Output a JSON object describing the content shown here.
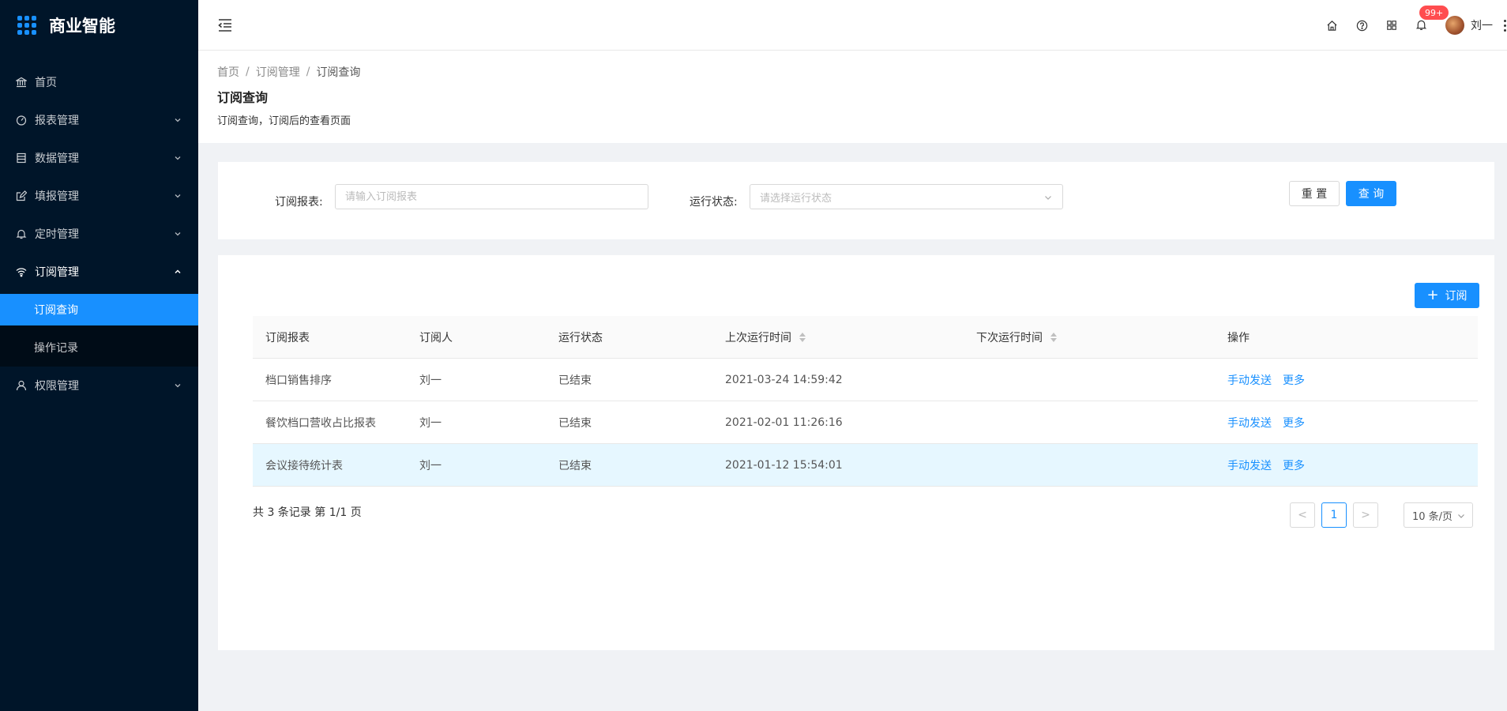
{
  "app": {
    "title": "商业智能"
  },
  "sidebar": {
    "items": [
      {
        "label": "首页",
        "icon": "bank-icon"
      },
      {
        "label": "报表管理",
        "icon": "dashboard-icon"
      },
      {
        "label": "数据管理",
        "icon": "database-icon"
      },
      {
        "label": "填报管理",
        "icon": "form-icon"
      },
      {
        "label": "定时管理",
        "icon": "bell-icon"
      },
      {
        "label": "订阅管理",
        "icon": "wifi-icon"
      },
      {
        "label": "权限管理",
        "icon": "user-icon"
      }
    ],
    "submenu": [
      {
        "label": "订阅查询"
      },
      {
        "label": "操作记录"
      }
    ]
  },
  "header": {
    "badge": "99+",
    "username": "刘一",
    "icons": [
      "home-icon",
      "question-icon",
      "appstore-icon",
      "bell-icon",
      "more-icon"
    ]
  },
  "page": {
    "breadcrumb": [
      "首页",
      "订阅管理",
      "订阅查询"
    ],
    "title": "订阅查询",
    "description": "订阅查询，订阅后的查看页面"
  },
  "search": {
    "report_label": "订阅报表:",
    "report_placeholder": "请输入订阅报表",
    "status_label": "运行状态:",
    "status_placeholder": "请选择运行状态",
    "reset_label": "重 置",
    "query_label": "查 询"
  },
  "table": {
    "add_label": "订阅",
    "columns": [
      "订阅报表",
      "订阅人",
      "运行状态",
      "上次运行时间",
      "下次运行时间",
      "操作"
    ],
    "rows": [
      {
        "report": "档口销售排序",
        "subscriber": "刘一",
        "status": "已结束",
        "last_run": "2021-03-24 14:59:42",
        "next_run": "",
        "action_send": "手动发送",
        "action_more": "更多"
      },
      {
        "report": "餐饮档口营收占比报表",
        "subscriber": "刘一",
        "status": "已结束",
        "last_run": "2021-02-01 11:26:16",
        "next_run": "",
        "action_send": "手动发送",
        "action_more": "更多"
      },
      {
        "report": "会议接待统计表",
        "subscriber": "刘一",
        "status": "已结束",
        "last_run": "2021-01-12 15:54:01",
        "next_run": "",
        "action_send": "手动发送",
        "action_more": "更多"
      }
    ],
    "highlighted_row": 2
  },
  "pagination": {
    "total_text": "共 3 条记录 第 1/1 页",
    "prev": "<",
    "current": "1",
    "next": ">",
    "page_size": "10 条/页"
  },
  "colors": {
    "primary": "#1890ff",
    "sidebar": "#001529",
    "badge": "#ff4d4f"
  }
}
